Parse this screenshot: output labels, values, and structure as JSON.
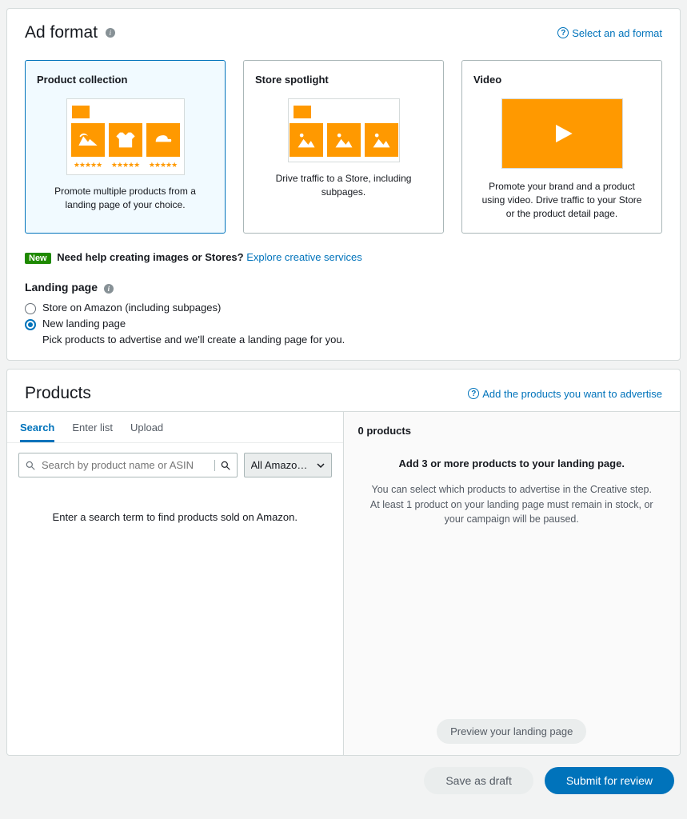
{
  "adFormat": {
    "title": "Ad format",
    "helpLink": "Select an ad format",
    "cards": [
      {
        "title": "Product collection",
        "desc": "Promote multiple products from a landing page of your choice."
      },
      {
        "title": "Store spotlight",
        "desc": "Drive traffic to a Store, including subpages."
      },
      {
        "title": "Video",
        "desc": "Promote your brand and a product using video. Drive traffic to your Store or the product detail page."
      }
    ],
    "banner": {
      "tag": "New",
      "text": "Need help creating images or Stores?",
      "link": "Explore creative services"
    },
    "landing": {
      "title": "Landing page",
      "options": [
        {
          "label": "Store on Amazon (including subpages)",
          "checked": false
        },
        {
          "label": "New landing page",
          "checked": true,
          "sub": "Pick products to advertise and we'll create a landing page for you."
        }
      ]
    }
  },
  "products": {
    "title": "Products",
    "helpLink": "Add the products you want to advertise",
    "tabs": [
      "Search",
      "Enter list",
      "Upload"
    ],
    "activeTab": 0,
    "search": {
      "placeholder": "Search by product name or ASIN"
    },
    "dropdown": {
      "label": "All Amazon p…"
    },
    "leftHint": "Enter a search term to find products sold on Amazon.",
    "countLabel": "0 products",
    "right": {
      "lead": "Add 3 or more products to your landing page.",
      "para": "You can select which products to advertise in the Creative step. At least 1 product on your landing page must remain in stock, or your campaign will be paused."
    },
    "previewBtn": "Preview your landing page"
  },
  "footer": {
    "saveDraft": "Save as draft",
    "submit": "Submit for review"
  }
}
